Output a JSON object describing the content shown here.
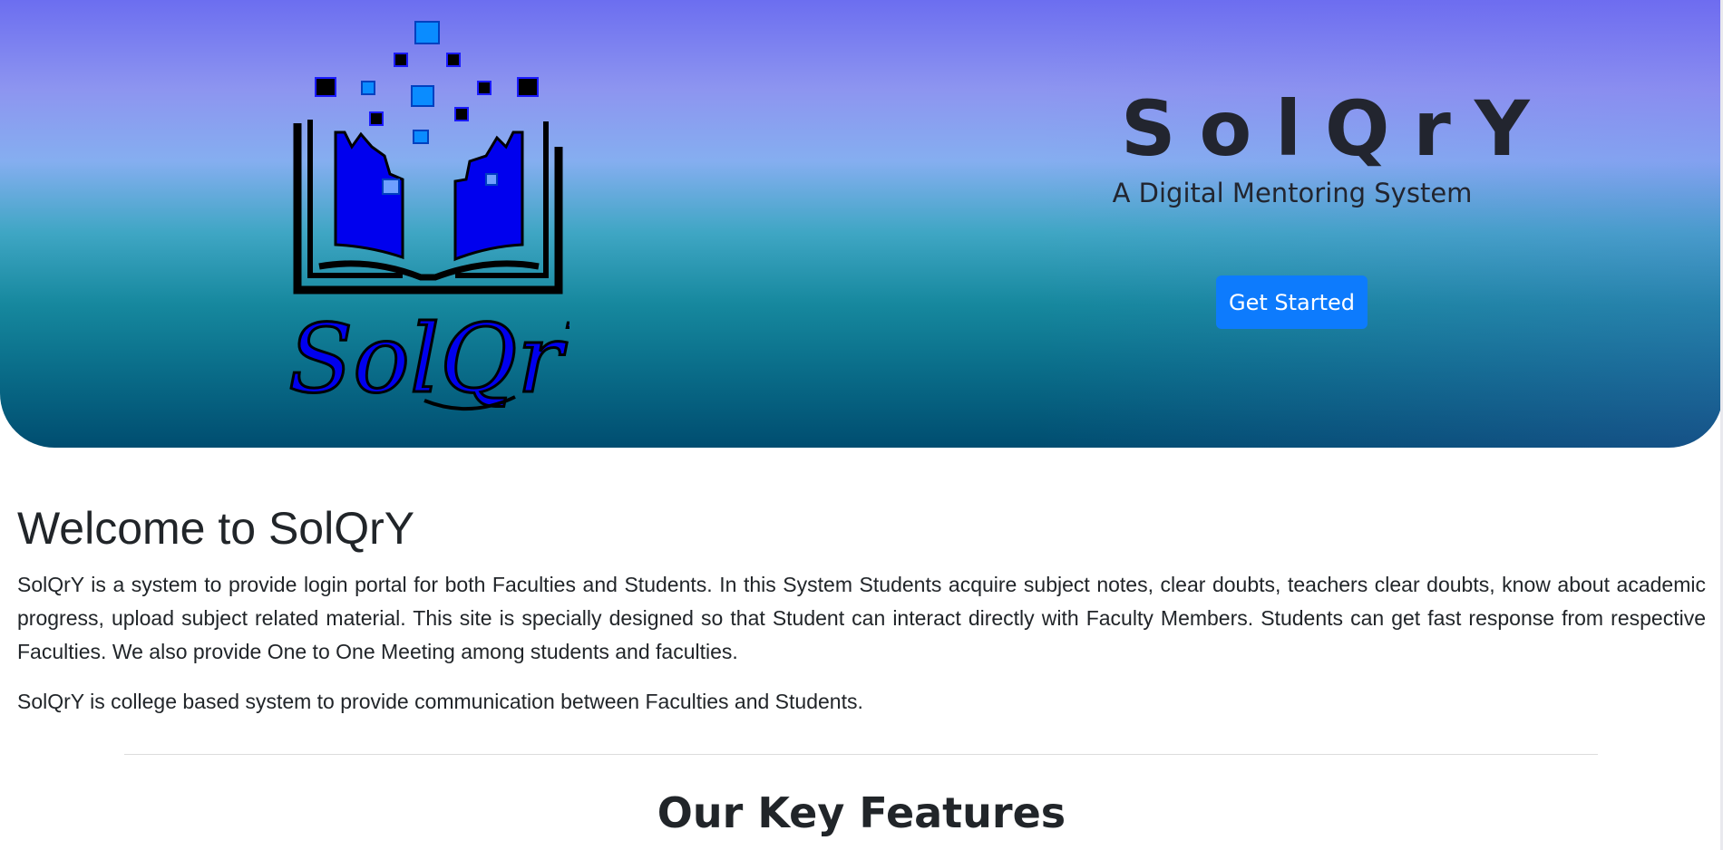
{
  "hero": {
    "logo_text": "SolQrY",
    "title": "SolQrY",
    "subtitle": "A Digital Mentoring System",
    "cta_label": "Get Started",
    "colors": {
      "button": "#0d7bfd",
      "book_fill": "#0000ee",
      "pixel_light": "#0a8cff",
      "dark": "#000000"
    }
  },
  "welcome": {
    "title": "Welcome to SolQrY",
    "paragraph1": "SolQrY is a system to provide login portal for both Faculties and Students. In this System Students acquire subject notes, clear doubts, teachers clear doubts, know about academic progress, upload subject related material. This site is specially designed so that Student can interact directly with Faculty Members. Students can get fast response from respective Faculties. We also provide One to One Meeting among students and faculties.",
    "paragraph2": "SolQrY is college based system to provide communication between Faculties and Students."
  },
  "features": {
    "title": "Our Key Features"
  },
  "icons": {
    "logo": "book-pixels-icon"
  }
}
